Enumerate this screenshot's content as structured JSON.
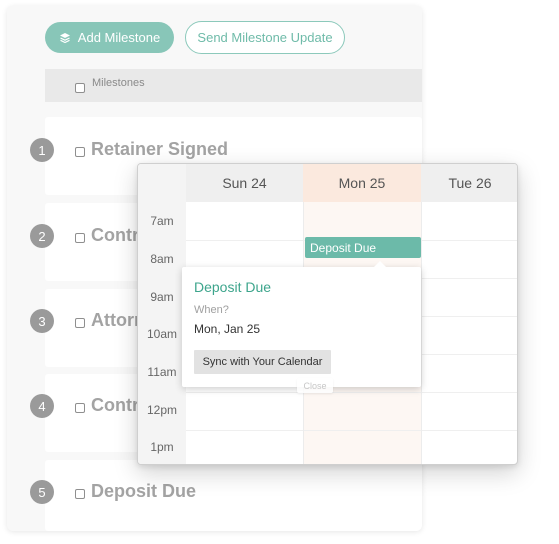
{
  "toolbar": {
    "add_label": "Add Milestone",
    "add_icon": "layers-icon",
    "send_label": "Send Milestone Update"
  },
  "list": {
    "header_label": "Milestones",
    "items": [
      {
        "number": "1",
        "title": "Retainer Signed"
      },
      {
        "number": "2",
        "title": "Contr"
      },
      {
        "number": "3",
        "title": "Attorn"
      },
      {
        "number": "4",
        "title": "Contr"
      },
      {
        "number": "5",
        "title": "Deposit Due"
      }
    ]
  },
  "calendar": {
    "days": [
      {
        "label": "Sun 24",
        "today": false
      },
      {
        "label": "Mon 25",
        "today": true
      },
      {
        "label": "Tue 26",
        "today": false
      }
    ],
    "times": [
      "7am",
      "8am",
      "9am",
      "10am",
      "11am",
      "12pm",
      "1pm"
    ],
    "event": {
      "title": "Deposit Due",
      "day": "Mon 25",
      "time": "8am"
    },
    "colors": {
      "accent": "#6cbaa9",
      "today_header": "#fbe9de",
      "today_column": "#fdf7f3"
    }
  },
  "popup": {
    "title": "Deposit Due",
    "when_label": "When?",
    "date": "Mon, Jan 25",
    "sync_label": "Sync with Your Calendar",
    "close_label": "Close"
  },
  "colors": {
    "brand": "#88c6b8",
    "brand_text": "#6fbba9",
    "popup_title": "#3da58c"
  }
}
